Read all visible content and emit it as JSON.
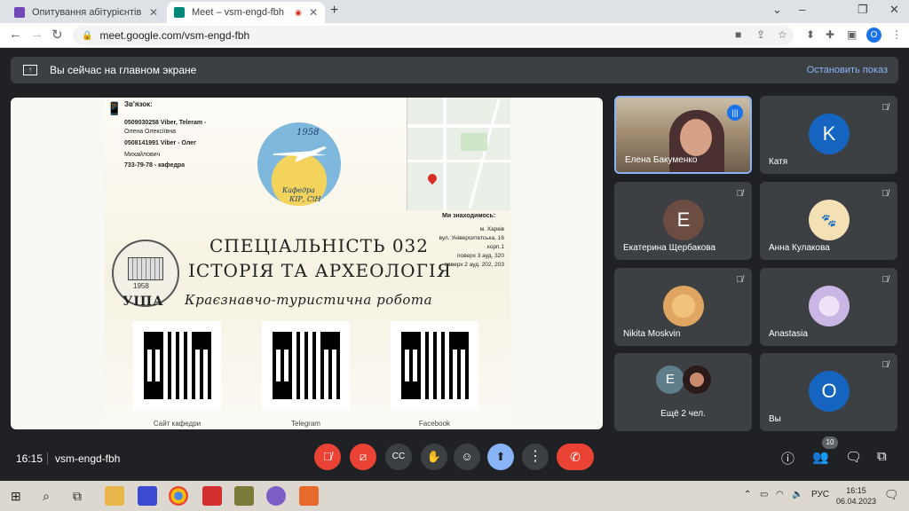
{
  "browser": {
    "tabs": [
      {
        "title": "Опитування абітурієнтів",
        "color": "#7248b9"
      },
      {
        "title": "Meet – vsm-engd-fbh",
        "color": "#00897b"
      }
    ],
    "new_tab": "+",
    "window_controls": [
      "⌄",
      "–",
      "❐",
      "✕"
    ],
    "url": "meet.google.com/vsm-engd-fbh",
    "profile_initial": "O"
  },
  "meet": {
    "presenting_banner": "Вы сейчас на главном экране",
    "stop_sharing": "Остановить показ",
    "slide": {
      "contact_title": "Зв'язок:",
      "contact_lines": [
        "0509030258 Viber, Teleram -",
        "Олена Олексіївна",
        "0508141991 Viber - Олег",
        "Михайлович",
        "733-79-78 - кафедра"
      ],
      "logo_year": "1958",
      "logo_text_1": "Кафедра",
      "logo_text_2": "КІР, СіН",
      "location_title": "Ми знаходимось:",
      "location_lines": [
        "м. Харків",
        "вул. Університетська, 16",
        "корп.1",
        "поверх 3 ауд. 320",
        "поверх 2 ауд. 202, 203"
      ],
      "seal_year": "1958",
      "seal_name": "УІПА",
      "heading_1": "СПЕЦІАЛЬНІСТЬ 032",
      "heading_2": "ІСТОРІЯ ТА АРХЕОЛОГІЯ",
      "heading_3": "Краєзнавчо-туристична робота",
      "qr_labels": [
        "Сайт кафедри",
        "Telegram",
        "Facebook"
      ]
    },
    "participants": [
      {
        "name": "Елена Бакуменко",
        "video": true
      },
      {
        "name": "Катя",
        "initial": "K",
        "color": "#1565c0"
      },
      {
        "name": "Екатерина Щербакова",
        "initial": "E",
        "color": "#6d4c41"
      },
      {
        "name": "Анна Кулакова",
        "initial": "",
        "color": "#f3e0b5"
      },
      {
        "name": "Nikita Moskvin",
        "initial": "",
        "color": "#e0a560"
      },
      {
        "name": "Anastasia",
        "initial": "",
        "color": "#c9b6e4"
      },
      {
        "name": "Ещё 2 чел.",
        "initial": "E",
        "color": "#607d8b"
      },
      {
        "name": "Вы",
        "initial": "O",
        "color": "#1565c0"
      }
    ],
    "bottom": {
      "time": "16:15",
      "meeting_code": "vsm-engd-fbh",
      "participant_count": "10"
    }
  },
  "taskbar": {
    "language": "РУС",
    "time": "16:15",
    "date": "06.04.2023"
  }
}
